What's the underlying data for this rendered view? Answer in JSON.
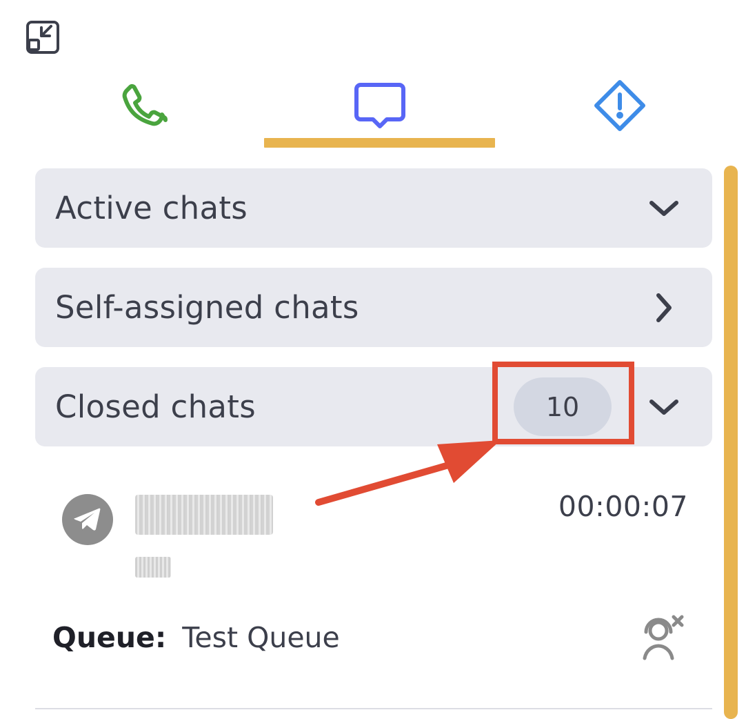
{
  "window": {
    "minimize_icon": "minimize-icon"
  },
  "tabs": [
    {
      "name": "Phone",
      "icon": "phone-icon",
      "color": "#4aa43e"
    },
    {
      "name": "Chat",
      "icon": "chat-icon",
      "color": "#5866f6",
      "active": true
    },
    {
      "name": "Alert",
      "icon": "alert-icon",
      "color": "#3e8ce8"
    }
  ],
  "accent": "#e8b44f",
  "sections": [
    {
      "title": "Active chats",
      "expanded": true
    },
    {
      "title": "Self-assigned chats",
      "expanded": false
    },
    {
      "title": "Closed chats",
      "expanded": true,
      "count": "10"
    }
  ],
  "closed_chat": {
    "channel_icon": "telegram-icon",
    "duration": "00:00:07",
    "queue_label": "Queue:",
    "queue_value": "Test Queue",
    "agent_icon": "agent-removed-icon"
  },
  "annotation": {
    "color": "#e14b33"
  }
}
